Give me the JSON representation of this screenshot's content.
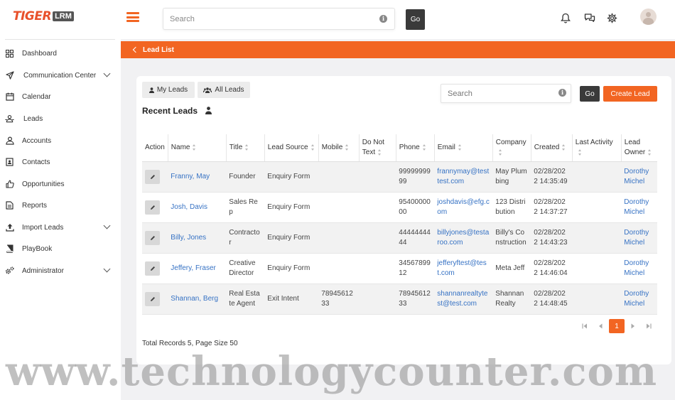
{
  "app": {
    "logo_primary": "TIGER",
    "logo_secondary": "LRM",
    "accent_color": "#f26522"
  },
  "header": {
    "search_placeholder": "Search",
    "go_label": "Go",
    "icons": [
      "bell-icon",
      "chat-icon",
      "gear-icon",
      "avatar"
    ]
  },
  "sidebar": {
    "items": [
      {
        "label": "Dashboard",
        "icon": "grid-icon",
        "expandable": false
      },
      {
        "label": "Communication Center",
        "icon": "send-icon",
        "expandable": true
      },
      {
        "label": "Calendar",
        "icon": "calendar-icon",
        "expandable": false
      },
      {
        "label": "Leads",
        "icon": "leads-icon",
        "expandable": false
      },
      {
        "label": "Accounts",
        "icon": "accounts-icon",
        "expandable": false
      },
      {
        "label": "Contacts",
        "icon": "contacts-icon",
        "expandable": false
      },
      {
        "label": "Opportunities",
        "icon": "thumbs-up-icon",
        "expandable": false
      },
      {
        "label": "Reports",
        "icon": "report-icon",
        "expandable": false
      },
      {
        "label": "Import Leads",
        "icon": "upload-icon",
        "expandable": true
      },
      {
        "label": "PlayBook",
        "icon": "book-icon",
        "expandable": false
      },
      {
        "label": "Administrator",
        "icon": "cogs-icon",
        "expandable": true
      }
    ]
  },
  "breadcrumb": {
    "label": "Lead List"
  },
  "leads": {
    "tabs": {
      "my_leads": "My Leads",
      "all_leads": "All Leads"
    },
    "search_placeholder": "Search",
    "go_label": "Go",
    "create_label": "Create Lead",
    "title": "Recent Leads",
    "columns": [
      "Action",
      "Name",
      "Title",
      "Lead Source",
      "Mobile",
      "Do Not Text",
      "Phone",
      "Email",
      "Company",
      "Created",
      "Last Activity",
      "Lead Owner"
    ],
    "rows": [
      {
        "name": "Franny, May",
        "title": "Founder",
        "source": "Enquiry Form",
        "mobile": "",
        "dnt": "",
        "phone": "9999999999",
        "email": "frannymay@testtest.com",
        "company": "May Plumbing",
        "created": "02/28/2022 14:35:49",
        "last_activity": "",
        "owner": "Dorothy Michel"
      },
      {
        "name": "Josh, Davis",
        "title": "Sales Rep",
        "source": "Enquiry Form",
        "mobile": "",
        "dnt": "",
        "phone": "9540000000",
        "email": "joshdavis@efg.com",
        "company": "123 Distribution",
        "created": "02/28/2022 14:37:27",
        "last_activity": "",
        "owner": "Dorothy Michel"
      },
      {
        "name": "Billy, Jones",
        "title": "Contractor",
        "source": "Enquiry Form",
        "mobile": "",
        "dnt": "",
        "phone": "4444444444",
        "email": "billyjones@testaroo.com",
        "company": "Billy's Construction",
        "created": "02/28/2022 14:43:23",
        "last_activity": "",
        "owner": "Dorothy Michel"
      },
      {
        "name": "Jeffery, Fraser",
        "title": "Creative Director",
        "source": "Enquiry Form",
        "mobile": "",
        "dnt": "",
        "phone": "3456789912",
        "email": "jefferyftest@test.com",
        "company": "Meta Jeff",
        "created": "02/28/2022 14:46:04",
        "last_activity": "",
        "owner": "Dorothy Michel"
      },
      {
        "name": "Shannan, Berg",
        "title": "Real Estate Agent",
        "source": "Exit Intent",
        "mobile": "7894561233",
        "dnt": "",
        "phone": "7894561233",
        "email": "shannanrealtytest@test.com",
        "company": "Shannan Realty",
        "created": "02/28/2022 14:48:45",
        "last_activity": "",
        "owner": "Dorothy Michel"
      }
    ],
    "pagination": {
      "current_page": "1"
    },
    "total_records_text": "Total Records 5, Page Size 50"
  },
  "watermark": "www.technologycounter.com"
}
